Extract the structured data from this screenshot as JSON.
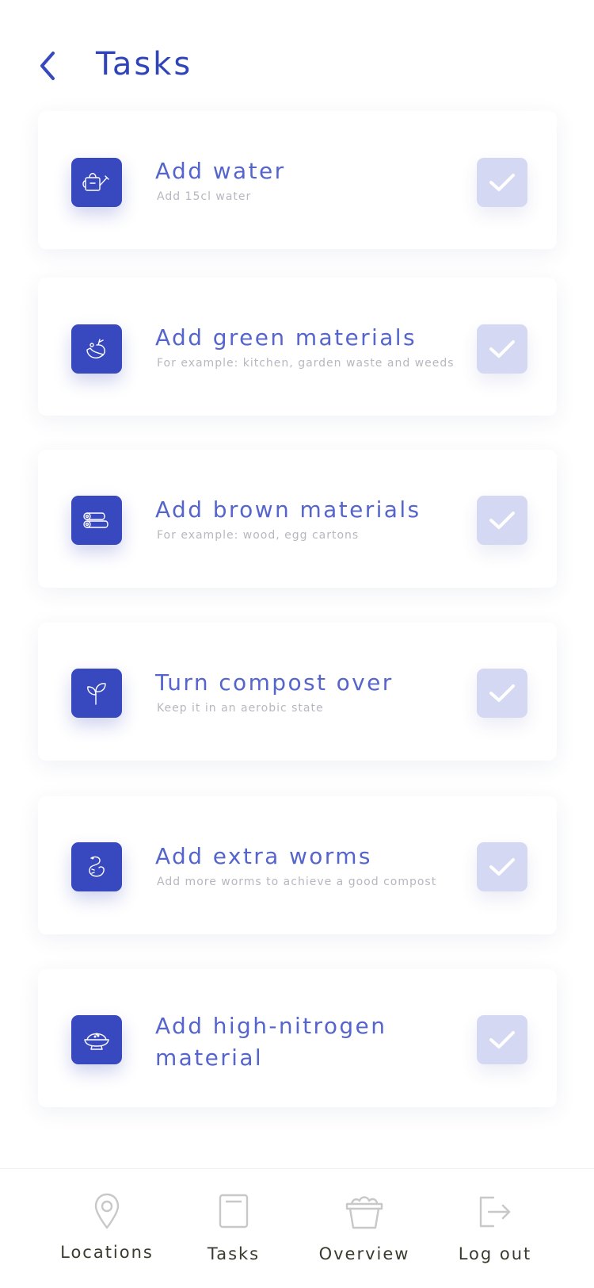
{
  "header": {
    "title": "Tasks"
  },
  "tasks": [
    {
      "title": "Add water",
      "description": "Add 15cl water",
      "icon": "watering-can-icon",
      "done": false
    },
    {
      "title": "Add green materials",
      "description": "For example: kitchen, garden waste and weeds",
      "icon": "vegetables-icon",
      "done": false
    },
    {
      "title": "Add brown materials",
      "description": "For example: wood, egg cartons",
      "icon": "wood-logs-icon",
      "done": false
    },
    {
      "title": "Turn compost over",
      "description": "Keep it in an aerobic state",
      "icon": "sprout-icon",
      "done": false
    },
    {
      "title": "Add extra worms",
      "description": "Add more worms to achieve a good compost",
      "icon": "worm-icon",
      "done": false
    },
    {
      "title": "Add high-nitrogen material",
      "description": "",
      "icon": "bowl-icon",
      "done": false
    }
  ],
  "tabbar": {
    "locations": "Locations",
    "tasks": "Tasks",
    "overview": "Overview",
    "logout": "Log out"
  },
  "colors": {
    "accent": "#3848bf",
    "title": "#2f44b8",
    "task_title": "#5565cc",
    "check_bg": "#d5d8f2",
    "muted": "#b7b7bf"
  }
}
